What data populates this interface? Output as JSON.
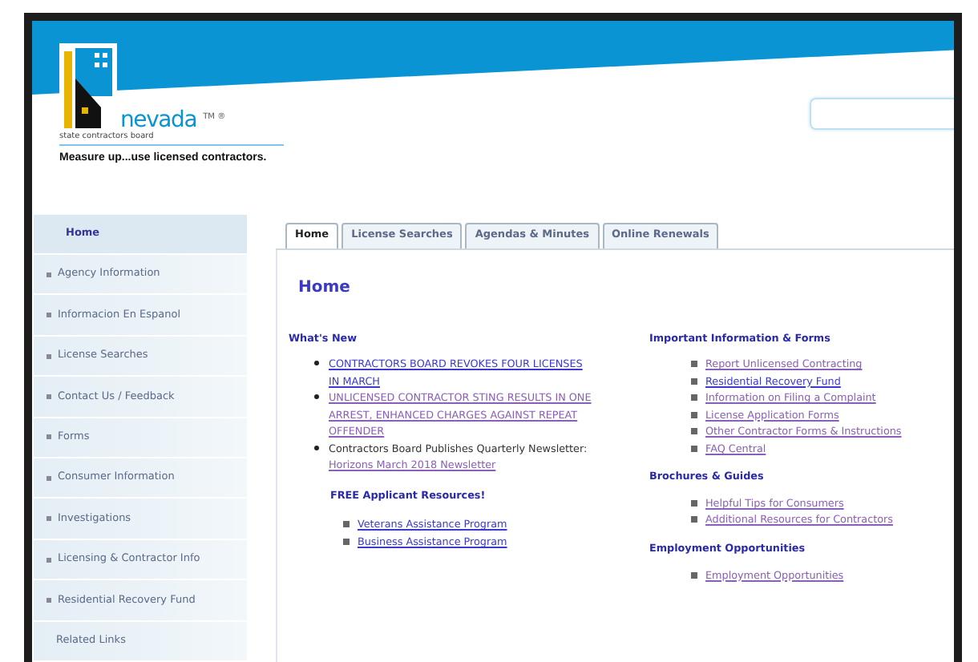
{
  "header": {
    "logo_word": "nevada",
    "logo_mark": "TM ®",
    "logo_subtitle": "state contractors board",
    "tagline": "Measure up...use licensed contractors."
  },
  "sidebar": {
    "items": [
      {
        "label": "Home",
        "selected": true,
        "expandable": false
      },
      {
        "label": "Agency Information",
        "selected": false,
        "expandable": true
      },
      {
        "label": "Informacion En Espanol",
        "selected": false,
        "expandable": true
      },
      {
        "label": "License Searches",
        "selected": false,
        "expandable": true
      },
      {
        "label": "Contact Us / Feedback",
        "selected": false,
        "expandable": true
      },
      {
        "label": "Forms",
        "selected": false,
        "expandable": true
      },
      {
        "label": "Consumer Information",
        "selected": false,
        "expandable": true
      },
      {
        "label": "Investigations",
        "selected": false,
        "expandable": true
      },
      {
        "label": "Licensing & Contractor Info",
        "selected": false,
        "expandable": true
      },
      {
        "label": "Residential Recovery Fund",
        "selected": false,
        "expandable": true
      },
      {
        "label": "Related Links",
        "selected": false,
        "expandable": false
      }
    ]
  },
  "tabs": [
    {
      "label": "Home",
      "selected": true
    },
    {
      "label": "License Searches",
      "selected": false
    },
    {
      "label": "Agendas & Minutes",
      "selected": false
    },
    {
      "label": "Online Renewals",
      "selected": false
    }
  ],
  "page_title": "Home",
  "left_column": {
    "heading": "What's New",
    "news": [
      {
        "link": "CONTRACTORS BOARD REVOKES FOUR LICENSES IN MARCH",
        "visited": false
      },
      {
        "link": "UNLICENSED CONTRACTOR STING RESULTS IN ONE ARREST, ENHANCED CHARGES AGAINST REPEAT OFFENDER",
        "visited": true
      },
      {
        "text": "Contractors Board Publishes Quarterly Newsletter: ",
        "link": "Horizons March 2018 Newsletter",
        "visited": true
      }
    ],
    "subheading": "FREE Applicant Resources!",
    "resources": [
      {
        "link": "Veterans Assistance Program",
        "visited": false
      },
      {
        "link": "Business Assistance Program",
        "visited": false
      }
    ]
  },
  "right_column": {
    "sections": [
      {
        "heading": "Important Information & Forms",
        "links": [
          {
            "link": "Report Unlicensed Contracting",
            "visited": true
          },
          {
            "link": "Residential Recovery Fund",
            "visited": false
          },
          {
            "link": "Information on Filing a Complaint",
            "visited": true
          },
          {
            "link": "License Application Forms",
            "visited": true
          },
          {
            "link": "Other Contractor Forms & Instructions",
            "visited": true
          },
          {
            "link": "FAQ Central",
            "visited": true
          }
        ]
      },
      {
        "heading": "Brochures & Guides",
        "links": [
          {
            "link": "Helpful Tips for Consumers",
            "visited": true
          },
          {
            "link": "Additional Resources for Contractors",
            "visited": true
          }
        ]
      },
      {
        "heading": "Employment Opportunities",
        "links": [
          {
            "link": "Employment Opportunities",
            "visited": true
          }
        ]
      }
    ]
  }
}
